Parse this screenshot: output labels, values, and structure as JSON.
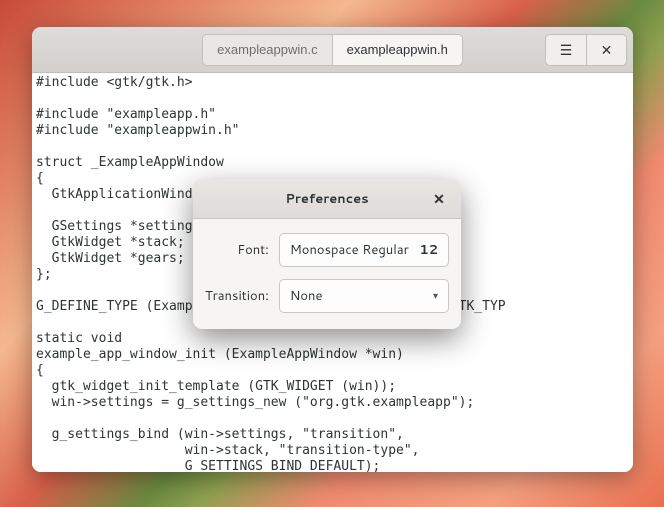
{
  "window": {
    "tabs": [
      {
        "label": "exampleappwin.c",
        "active": false
      },
      {
        "label": "exampleappwin.h",
        "active": true
      }
    ],
    "menu_icon": "☰",
    "close_icon": "✕"
  },
  "code": "#include <gtk/gtk.h>\n\n#include \"exampleapp.h\"\n#include \"exampleappwin.h\"\n\nstruct _ExampleAppWindow\n{\n  GtkApplicationWindow parent;\n\n  GSettings *settings;\n  GtkWidget *stack;\n  GtkWidget *gears;\n};\n\nG_DEFINE_TYPE (ExampleAppWindow, example_app_window, GTK_TYP\n\nstatic void\nexample_app_window_init (ExampleAppWindow *win)\n{\n  gtk_widget_init_template (GTK_WIDGET (win));\n  win->settings = g_settings_new (\"org.gtk.exampleapp\");\n\n  g_settings_bind (win->settings, \"transition\",\n                   win->stack, \"transition-type\",\n                   G_SETTINGS_BIND_DEFAULT);",
  "dialog": {
    "title": "Preferences",
    "close_icon": "✕",
    "font_label": "Font:",
    "font_value": "Monospace Regular",
    "font_size": "12",
    "transition_label": "Transition:",
    "transition_value": "None",
    "chevron": "▾"
  }
}
